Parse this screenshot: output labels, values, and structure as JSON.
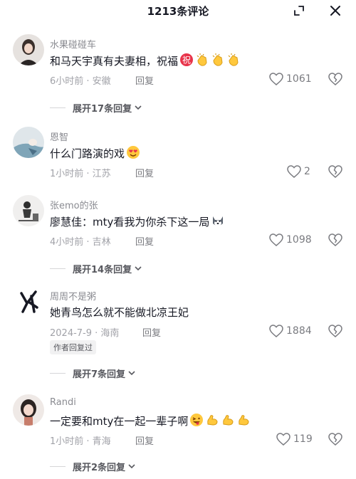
{
  "header": {
    "title": "1213条评论",
    "collapse_icon": "collapse-icon",
    "close_icon": "close-icon"
  },
  "comments": [
    {
      "username": "水果碰碰车",
      "text": "和马天宇真有夫妻相，祝福",
      "emojis": [
        "祝",
        "clap",
        "clap",
        "clap"
      ],
      "time_location": "6小时前 · 安徽",
      "reply_label": "回复",
      "likes": "1061",
      "expand": "展开17条回复"
    },
    {
      "username": "恩智",
      "text": "什么门路演的戏",
      "emojis": [
        "heart-eyes"
      ],
      "time_location": "1小时前 · 江苏",
      "reply_label": "回复",
      "likes": "2"
    },
    {
      "username": "张emo的张",
      "text": "廖慧佳：mty看我为你杀下这一局",
      "emojis": [
        "husky"
      ],
      "time_location": "4小时前 · 吉林",
      "reply_label": "回复",
      "likes": "1098",
      "expand": "展开14条回复"
    },
    {
      "username": "周周不是粥",
      "text": "她青鸟怎么就不能做北凉王妃",
      "emojis": [],
      "time_location": "2024-7-9 · 海南",
      "reply_label": "回复",
      "likes": "1884",
      "badge": "作者回复过",
      "expand": "展开7条回复"
    },
    {
      "username": "Randi",
      "text": "一定要和mty在一起一辈子啊",
      "emojis": [
        "laugh-tongue",
        "flex",
        "flex",
        "flex"
      ],
      "time_location": "1小时前 · 青海",
      "reply_label": "回复",
      "likes": "119",
      "expand": "展开2条回复"
    }
  ],
  "colors": {
    "accent_red": "#e8334a",
    "emoji_yellow": "#ffc83d",
    "muted": "#a1a2a8"
  }
}
